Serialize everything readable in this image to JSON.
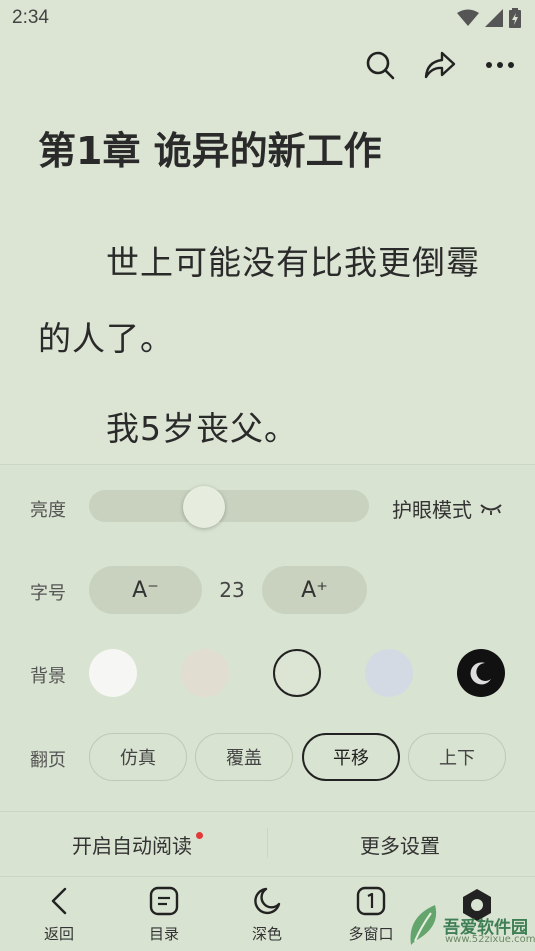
{
  "status": {
    "time": "2:34"
  },
  "chapter": {
    "title": "第1章 诡异的新工作"
  },
  "content": {
    "paragraph1_line1": "世上可能没有比我更倒霉",
    "paragraph1_line2": "的人了。",
    "paragraph2": "我5岁丧父。"
  },
  "settings": {
    "brightness_label": "亮度",
    "brightness_value": 0.34,
    "eye_mode_label": "护眼模式",
    "font_label": "字号",
    "font_decrease": "A⁻",
    "font_size": "23",
    "font_increase": "A⁺",
    "bg_label": "背景",
    "backgrounds": [
      {
        "color": "#f6f6f4"
      },
      {
        "color": "#e1ddd0"
      },
      {
        "color": "#dce5d3",
        "selected": true
      },
      {
        "color": "#d3dae3"
      },
      {
        "color": "#111111"
      }
    ],
    "page_label": "翻页",
    "page_modes": [
      "仿真",
      "覆盖",
      "平移",
      "上下"
    ],
    "page_selected": "平移"
  },
  "bottom_links": {
    "auto_read": "开启自动阅读",
    "more_settings": "更多设置"
  },
  "nav": {
    "back": "返回",
    "toc": "目录",
    "dark": "深色",
    "multiwindow": "多窗口"
  },
  "watermark": {
    "name": "吾爱软件园",
    "url": "www.52zixue.com"
  },
  "colors": {
    "background": "#dce5d3",
    "accent_dot": "#e23a3a"
  }
}
